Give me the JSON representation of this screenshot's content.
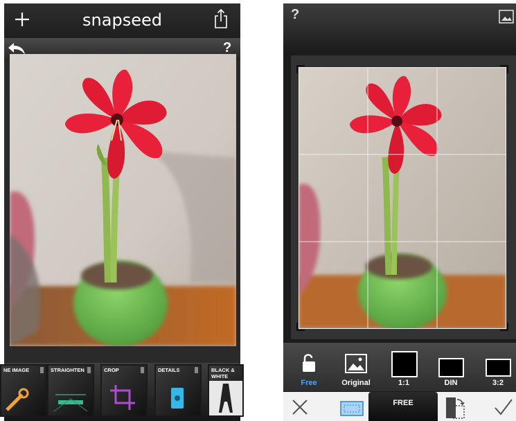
{
  "left_screen": {
    "app_title": "snapseed",
    "help_label": "?",
    "tools": [
      {
        "label": "NE IMAGE"
      },
      {
        "label": "STRAIGHTEN"
      },
      {
        "label": "CROP"
      },
      {
        "label": "DETAILS"
      },
      {
        "label": "BLACK &\nWHITE"
      }
    ]
  },
  "right_screen": {
    "help_label": "?",
    "aspect_options": [
      {
        "label": "Free",
        "color": "#4aa3ff"
      },
      {
        "label": "Original",
        "color": "#ffffff"
      },
      {
        "label": "1:1",
        "color": "#ffffff"
      },
      {
        "label": "DIN",
        "color": "#ffffff"
      },
      {
        "label": "3:2",
        "color": "#ffffff"
      }
    ],
    "selected_mode": "FREE"
  },
  "colors": {
    "accent_blue": "#4aa3ff",
    "flower_red": "#e8203a",
    "pot_green": "#62b24a"
  }
}
